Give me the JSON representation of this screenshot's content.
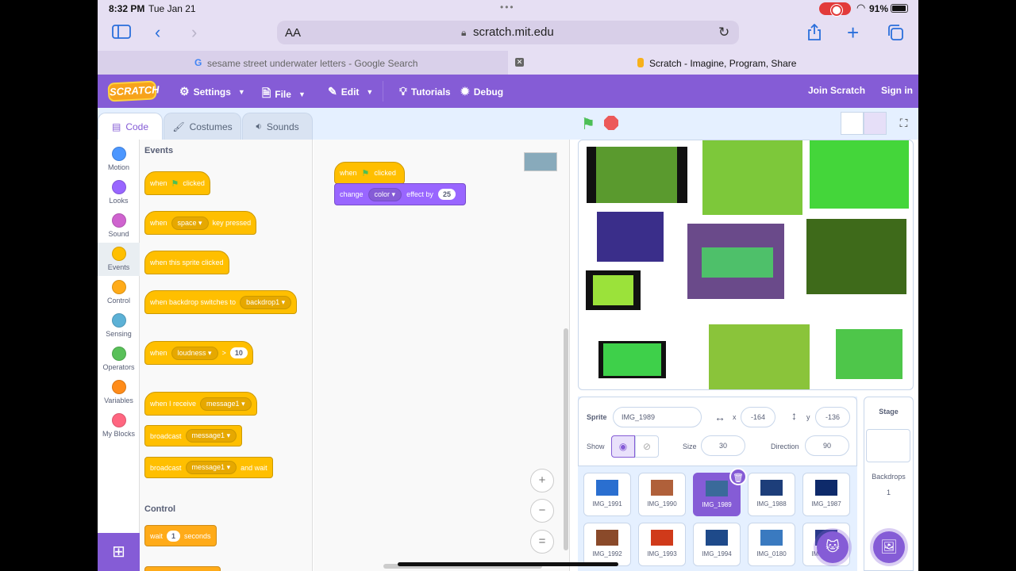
{
  "status": {
    "time": "8:32 PM",
    "date": "Tue Jan 21",
    "battery": "91%"
  },
  "browser": {
    "aa": "AA",
    "url": "scratch.mit.edu",
    "tabs": [
      {
        "title": "sesame street underwater letters - Google Search"
      },
      {
        "title": "Scratch - Imagine, Program, Share"
      }
    ]
  },
  "menu": {
    "logo": "SCRATCH",
    "settings": "Settings",
    "file": "File",
    "edit": "Edit",
    "tutorials": "Tutorials",
    "debug": "Debug",
    "join": "Join Scratch",
    "signin": "Sign in"
  },
  "editor_tabs": {
    "code": "Code",
    "costumes": "Costumes",
    "sounds": "Sounds"
  },
  "categories": [
    {
      "label": "Motion",
      "color": "#4c97ff"
    },
    {
      "label": "Looks",
      "color": "#9966ff"
    },
    {
      "label": "Sound",
      "color": "#cf63cf"
    },
    {
      "label": "Events",
      "color": "#ffbf00"
    },
    {
      "label": "Control",
      "color": "#ffab19"
    },
    {
      "label": "Sensing",
      "color": "#5cb1d6"
    },
    {
      "label": "Operators",
      "color": "#59c059"
    },
    {
      "label": "Variables",
      "color": "#ff8c1a"
    },
    {
      "label": "My Blocks",
      "color": "#ff6680"
    }
  ],
  "palette": {
    "events_heading": "Events",
    "control_heading": "Control",
    "when": "when",
    "clicked": "clicked",
    "space": "space",
    "key_pressed": "key pressed",
    "when_sprite_clicked": "when this sprite clicked",
    "when_backdrop": "when backdrop switches to",
    "backdrop1": "backdrop1",
    "loudness": "loudness",
    "gt": ">",
    "ten": "10",
    "when_receive": "when I receive",
    "message1": "message1",
    "broadcast": "broadcast",
    "and_wait": "and wait",
    "wait": "wait",
    "one": "1",
    "seconds": "seconds"
  },
  "script": {
    "when": "when",
    "clicked": "clicked",
    "change": "change",
    "color": "color",
    "effect_by": "effect by",
    "amount": "25"
  },
  "zoom": {
    "in": "+",
    "out": "−",
    "reset": "="
  },
  "sprite": {
    "label": "Sprite",
    "name": "IMG_1989",
    "x_label": "x",
    "x": "-164",
    "y_label": "y",
    "y": "-136",
    "show_label": "Show",
    "size_label": "Size",
    "size": "30",
    "direction_label": "Direction",
    "direction": "90"
  },
  "sprites": [
    {
      "name": "IMG_1991",
      "color": "#2a6fd0"
    },
    {
      "name": "IMG_1990",
      "color": "#b0603a"
    },
    {
      "name": "IMG_1989",
      "color": "#3a6a9a"
    },
    {
      "name": "IMG_1988",
      "color": "#1d3e7a"
    },
    {
      "name": "IMG_1987",
      "color": "#0e2a6a"
    },
    {
      "name": "IMG_1992",
      "color": "#8a4a2a"
    },
    {
      "name": "IMG_1993",
      "color": "#d03a1a"
    },
    {
      "name": "IMG_1994",
      "color": "#1e4a8a"
    },
    {
      "name": "IMG_0180",
      "color": "#3a7ac0"
    },
    {
      "name": "IMG_0181",
      "color": "#2a3a8a"
    }
  ],
  "stage_target": {
    "title": "Stage",
    "backdrops_label": "Backdrops",
    "backdrops_count": "1"
  }
}
